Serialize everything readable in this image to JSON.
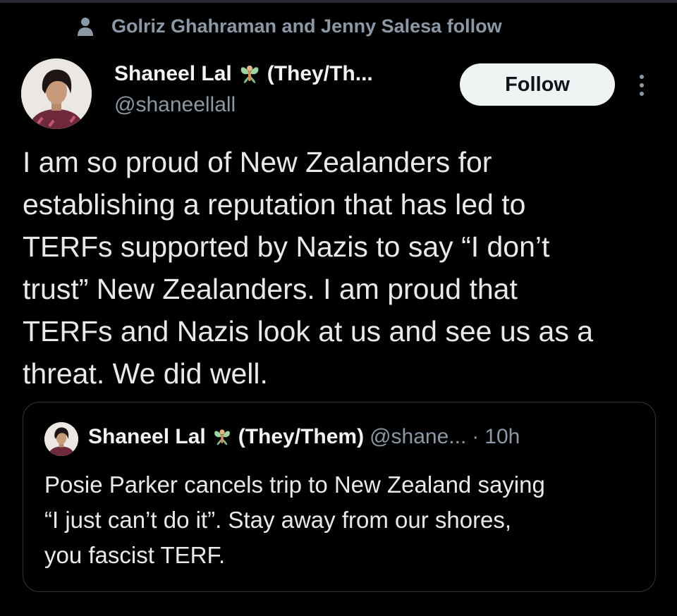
{
  "social_context": {
    "icon": "person-icon",
    "text": "Golriz Ghahraman and Jenny Salesa follow"
  },
  "author": {
    "name": "Shaneel Lal",
    "emoji_icon": "fairy-emoji-icon",
    "pronouns": "(They/Th...",
    "handle": "@shaneellall"
  },
  "follow_button": {
    "label": "Follow"
  },
  "more_icon": "more-vertical-icon",
  "tweet": {
    "text": "I am so proud of New Zealanders for\nestablishing a reputation that has led to\nTERFs supported by Nazis to say “I don’t\ntrust” New Zealanders. I am proud that\nTERFs and Nazis look at us and see us as a\nthreat. We did well."
  },
  "quoted_tweet": {
    "name": "Shaneel Lal",
    "emoji_icon": "fairy-emoji-icon",
    "pronouns": "(They/Them)",
    "handle": "@shane...",
    "dot": "·",
    "time": "10h",
    "text": "Posie Parker cancels trip to New Zealand saying\n“I just can’t do it”. Stay away from our shores,\nyou fascist TERF."
  },
  "colors": {
    "background": "#000000",
    "text_primary": "#e7e9ea",
    "text_secondary": "#8b98a5",
    "button_bg": "#eff3f4",
    "border": "#333639"
  }
}
